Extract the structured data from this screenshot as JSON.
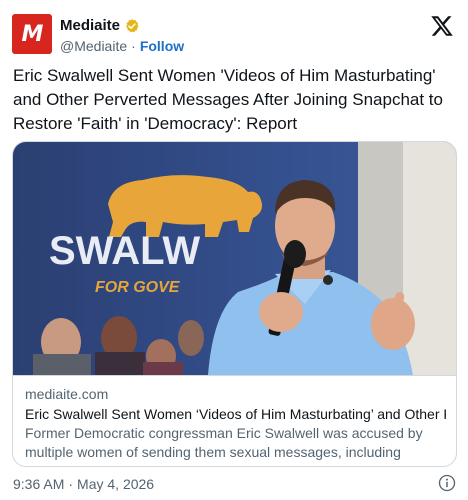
{
  "account": {
    "display_name": "Mediaite",
    "avatar_letter": "M",
    "handle": "@Mediaite",
    "separator": "·",
    "follow_label": "Follow"
  },
  "tweet": {
    "text": "Eric Swalwell Sent Women 'Videos of Him Masturbating' and Other Perverted Messages After Joining Snapchat to Restore 'Faith' in 'Democracy': Report"
  },
  "photo": {
    "sign_text": "SWALW",
    "sign_subtext": "FOR GOVE"
  },
  "link_card": {
    "domain": "mediaite.com",
    "title": "Eric Swalwell Sent Women ‘Videos of Him Masturbating’ and Other Perv...",
    "description": "Former Democratic congressman Eric Swalwell was accused by multiple women of sending them sexual messages, including “videos of him ..."
  },
  "footer": {
    "time": "9:36 AM",
    "separator": "·",
    "date": "May 4, 2026"
  },
  "icons": {
    "logo": "x-logo-icon",
    "verified": "verified-badge-icon",
    "info": "info-icon"
  },
  "colors": {
    "brand_red": "#d7261e",
    "follow_blue": "#1d6fc9",
    "verified_gold": "#e2b719",
    "sign_blue": "#2f4a8a",
    "sign_gold": "#e8a63a",
    "shirt_blue": "#8fc0ee"
  }
}
